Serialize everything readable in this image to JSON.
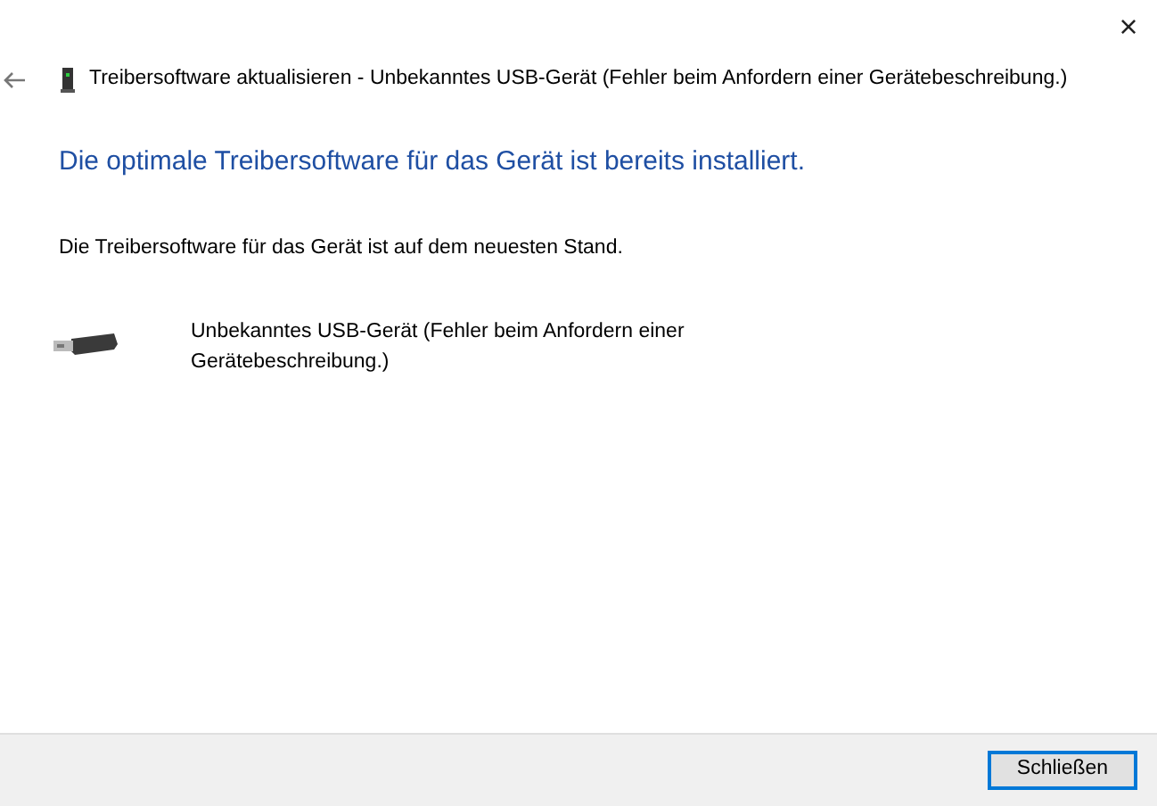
{
  "window": {
    "title": "Treibersoftware aktualisieren - Unbekanntes USB-Gerät (Fehler beim Anfordern einer Gerätebeschreibung.)",
    "close": "×"
  },
  "heading": "Die optimale Treibersoftware für das Gerät ist bereits installiert.",
  "message": "Die Treibersoftware für das Gerät ist auf dem neuesten Stand.",
  "device": {
    "name": "Unbekanntes USB-Gerät (Fehler beim Anfordern einer Gerätebeschreibung.)"
  },
  "buttons": [
    {
      "label": "Schließen",
      "default": true
    }
  ]
}
